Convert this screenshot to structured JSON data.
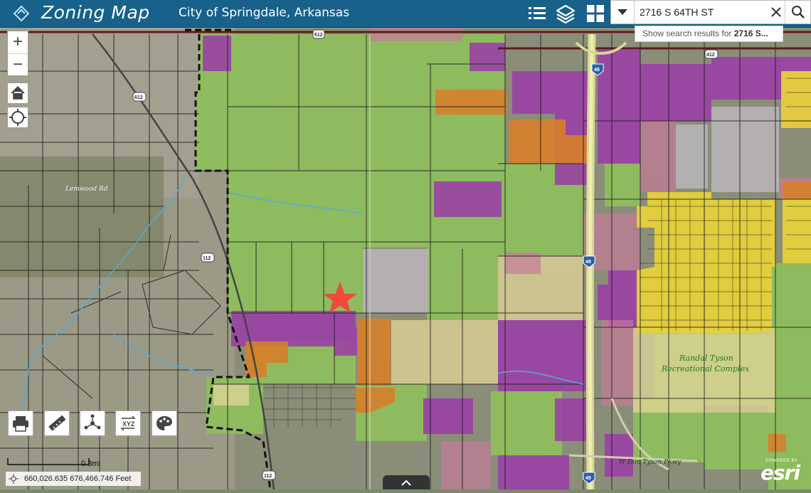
{
  "header": {
    "title": "Zoning Map",
    "subtitle": "City of Springdale, Arkansas"
  },
  "search": {
    "value": "2716 S 64TH ST",
    "hint_prefix": "Show search results for ",
    "hint_bold": "2716 S..."
  },
  "map": {
    "scale_label": "0.3mi",
    "coordinates": "660,026.635 676,466.746 Feet",
    "labels": {
      "park_line1": "Randal Tyson",
      "park_line2": "Recreational Complex",
      "road_sw": "W Don Tyson Pkwy",
      "road_name": "Lemwood Rd"
    },
    "shields": [
      "412",
      "612",
      "612",
      "112",
      "112",
      "49",
      "49",
      "49",
      "412"
    ]
  },
  "esri": {
    "powered": "POWERED BY",
    "word": "esri"
  },
  "colors": {
    "header": "#17618a",
    "agricultural": "#8fbf5c",
    "commercial": "#9b3fa6",
    "industrial": "#d77f2a",
    "residential": "#e6d13a",
    "marker": "#f04a3c"
  }
}
